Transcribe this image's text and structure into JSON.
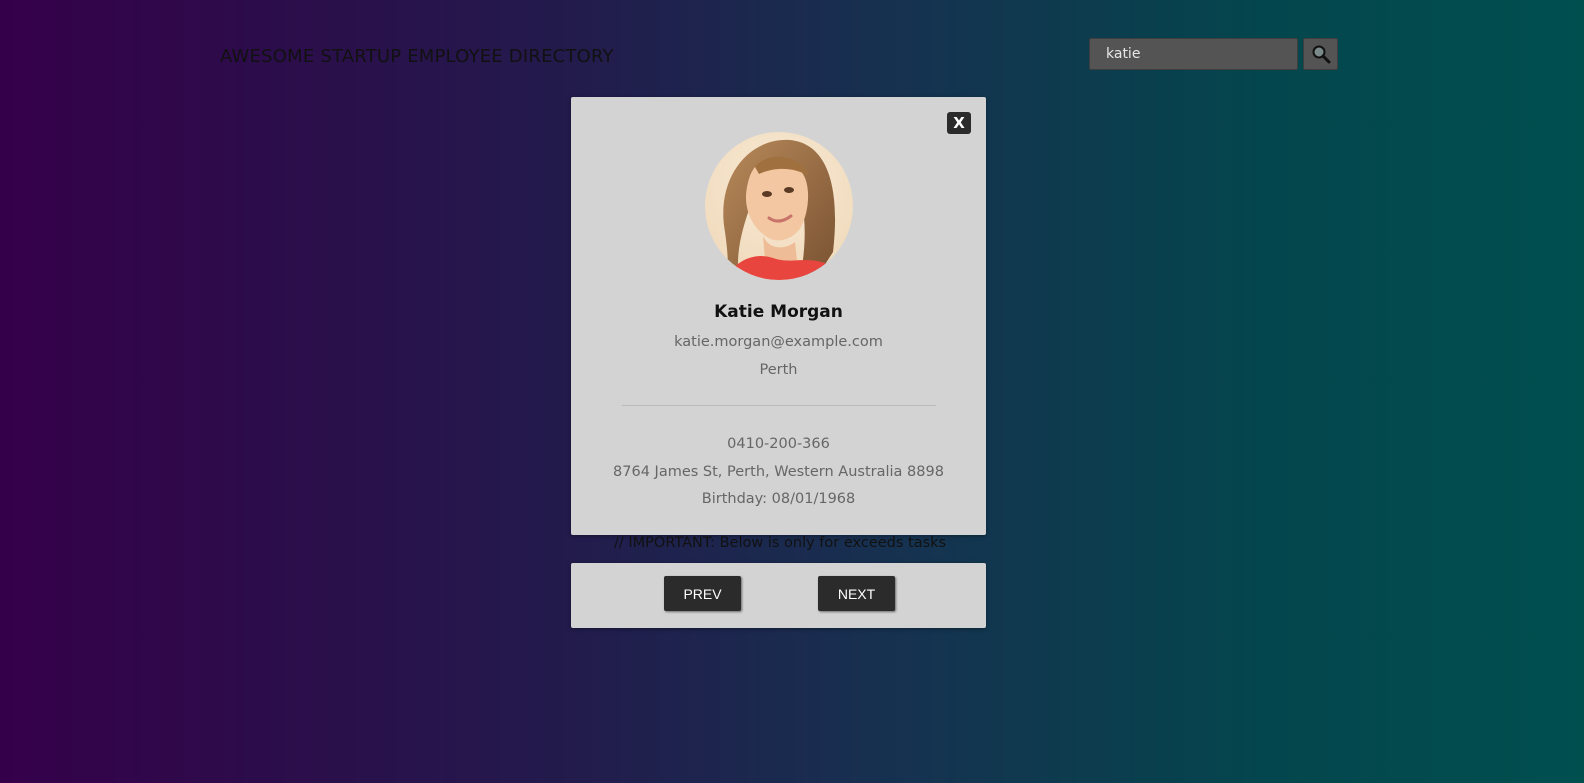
{
  "header": {
    "title": "AWESOME STARTUP EMPLOYEE DIRECTORY"
  },
  "search": {
    "value": "katie",
    "button_icon": "magnifier-icon"
  },
  "modal": {
    "close_label": "X",
    "avatar": "woman-portrait-avatar",
    "name": "Katie Morgan",
    "email": "katie.morgan@example.com",
    "city": "Perth",
    "phone": "0410-200-366",
    "address": "8764 James St, Perth, Western Australia 8898",
    "birthday": "Birthday: 08/01/1968"
  },
  "note": "// IMPORTANT: Below is only for exceeds tasks",
  "nav": {
    "prev_label": "PREV",
    "next_label": "NEXT"
  }
}
